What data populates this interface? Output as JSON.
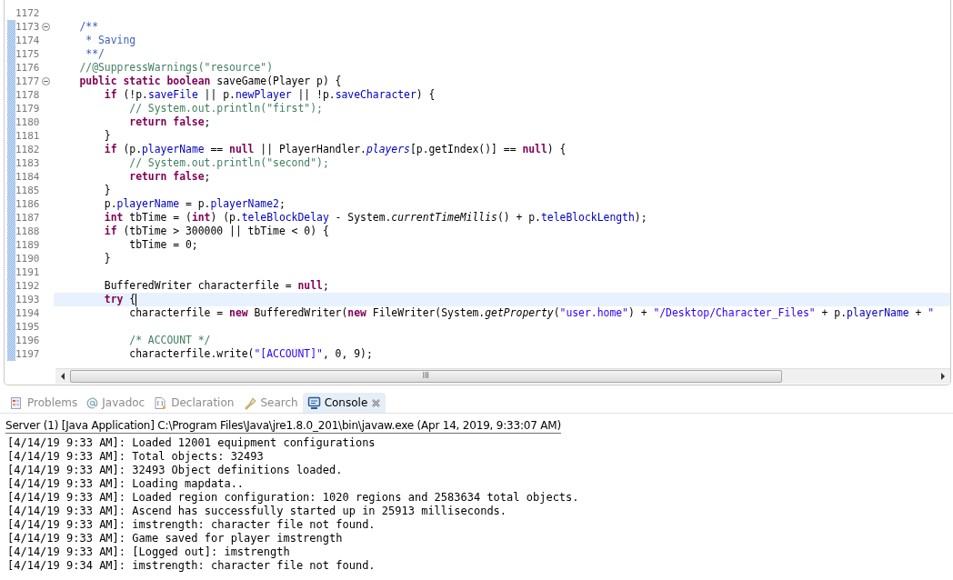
{
  "editor": {
    "lines": [
      {
        "number": "1172",
        "fold": false,
        "changed": false,
        "current": false
      },
      {
        "number": "1173",
        "fold": true,
        "changed": true,
        "current": false,
        "tokens": [
          {
            "text": "    /**",
            "kind": "javadoc"
          }
        ]
      },
      {
        "number": "1174",
        "fold": false,
        "changed": true,
        "current": false,
        "tokens": [
          {
            "text": "     * Saving",
            "kind": "javadoc"
          }
        ]
      },
      {
        "number": "1175",
        "fold": false,
        "changed": true,
        "current": false,
        "tokens": [
          {
            "text": "     **/",
            "kind": "javadoc"
          }
        ]
      },
      {
        "number": "1176",
        "fold": false,
        "changed": true,
        "current": false,
        "tokens": [
          {
            "text": "    //@SuppressWarnings(\"resource\")",
            "kind": "comment"
          }
        ]
      },
      {
        "number": "1177",
        "fold": true,
        "changed": true,
        "current": false,
        "tokens": [
          {
            "text": "    public static boolean",
            "kind": "keyword"
          },
          {
            "text": " saveGame(Player p) {",
            "kind": "plain"
          }
        ]
      },
      {
        "number": "1178",
        "fold": false,
        "changed": true,
        "current": false,
        "tokens": [
          {
            "text": "        if",
            "kind": "keyword"
          },
          {
            "text": " (!p.",
            "kind": "plain"
          },
          {
            "text": "saveFile",
            "kind": "field"
          },
          {
            "text": " || p.",
            "kind": "plain"
          },
          {
            "text": "newPlayer",
            "kind": "field"
          },
          {
            "text": " || !p.",
            "kind": "plain"
          },
          {
            "text": "saveCharacter",
            "kind": "field"
          },
          {
            "text": ") {",
            "kind": "plain"
          }
        ]
      },
      {
        "number": "1179",
        "fold": false,
        "changed": true,
        "current": false,
        "tokens": [
          {
            "text": "            // System.out.println(\"first\");",
            "kind": "comment"
          }
        ]
      },
      {
        "number": "1180",
        "fold": false,
        "changed": true,
        "current": false,
        "tokens": [
          {
            "text": "            return false",
            "kind": "keyword"
          },
          {
            "text": ";",
            "kind": "plain"
          }
        ]
      },
      {
        "number": "1181",
        "fold": false,
        "changed": true,
        "current": false,
        "tokens": [
          {
            "text": "        }",
            "kind": "plain"
          }
        ]
      },
      {
        "number": "1182",
        "fold": false,
        "changed": true,
        "current": false,
        "tokens": [
          {
            "text": "        if",
            "kind": "keyword"
          },
          {
            "text": " (p.",
            "kind": "plain"
          },
          {
            "text": "playerName",
            "kind": "field"
          },
          {
            "text": " == ",
            "kind": "plain"
          },
          {
            "text": "null",
            "kind": "keyword"
          },
          {
            "text": " || PlayerHandler.",
            "kind": "plain"
          },
          {
            "text": "players",
            "kind": "static_field"
          },
          {
            "text": "[p.getIndex()] == ",
            "kind": "plain"
          },
          {
            "text": "null",
            "kind": "keyword"
          },
          {
            "text": ") {",
            "kind": "plain"
          }
        ]
      },
      {
        "number": "1183",
        "fold": false,
        "changed": true,
        "current": false,
        "tokens": [
          {
            "text": "            // System.out.println(\"second\");",
            "kind": "comment"
          }
        ]
      },
      {
        "number": "1184",
        "fold": false,
        "changed": true,
        "current": false,
        "tokens": [
          {
            "text": "            return false",
            "kind": "keyword"
          },
          {
            "text": ";",
            "kind": "plain"
          }
        ]
      },
      {
        "number": "1185",
        "fold": false,
        "changed": true,
        "current": false,
        "tokens": [
          {
            "text": "        }",
            "kind": "plain"
          }
        ]
      },
      {
        "number": "1186",
        "fold": false,
        "changed": true,
        "current": false,
        "tokens": [
          {
            "text": "        p.",
            "kind": "plain"
          },
          {
            "text": "playerName",
            "kind": "field"
          },
          {
            "text": " = p.",
            "kind": "plain"
          },
          {
            "text": "playerName2",
            "kind": "field"
          },
          {
            "text": ";",
            "kind": "plain"
          }
        ]
      },
      {
        "number": "1187",
        "fold": false,
        "changed": true,
        "current": false,
        "tokens": [
          {
            "text": "        int",
            "kind": "keyword"
          },
          {
            "text": " tbTime = (",
            "kind": "plain"
          },
          {
            "text": "int",
            "kind": "keyword"
          },
          {
            "text": ") (p.",
            "kind": "plain"
          },
          {
            "text": "teleBlockDelay",
            "kind": "field"
          },
          {
            "text": " - System.",
            "kind": "plain"
          },
          {
            "text": "currentTimeMillis",
            "kind": "static_method"
          },
          {
            "text": "() + p.",
            "kind": "plain"
          },
          {
            "text": "teleBlockLength",
            "kind": "field"
          },
          {
            "text": ");",
            "kind": "plain"
          }
        ]
      },
      {
        "number": "1188",
        "fold": false,
        "changed": true,
        "current": false,
        "tokens": [
          {
            "text": "        if",
            "kind": "keyword"
          },
          {
            "text": " (tbTime > 300000 || tbTime < 0) {",
            "kind": "plain"
          }
        ]
      },
      {
        "number": "1189",
        "fold": false,
        "changed": true,
        "current": false,
        "tokens": [
          {
            "text": "            tbTime = 0;",
            "kind": "plain"
          }
        ]
      },
      {
        "number": "1190",
        "fold": false,
        "changed": true,
        "current": false,
        "tokens": [
          {
            "text": "        }",
            "kind": "plain"
          }
        ]
      },
      {
        "number": "1191",
        "fold": false,
        "changed": true,
        "current": false
      },
      {
        "number": "1192",
        "fold": false,
        "changed": true,
        "current": false,
        "tokens": [
          {
            "text": "        BufferedWriter characterfile = ",
            "kind": "plain"
          },
          {
            "text": "null",
            "kind": "keyword"
          },
          {
            "text": ";",
            "kind": "plain"
          }
        ]
      },
      {
        "number": "1193",
        "fold": false,
        "changed": true,
        "current": true,
        "tokens": [
          {
            "text": "        try",
            "kind": "keyword"
          },
          {
            "text": " {",
            "kind": "plain"
          }
        ]
      },
      {
        "number": "1194",
        "fold": false,
        "changed": true,
        "current": false,
        "tokens": [
          {
            "text": "            characterfile = ",
            "kind": "plain"
          },
          {
            "text": "new",
            "kind": "keyword"
          },
          {
            "text": " BufferedWriter(",
            "kind": "plain"
          },
          {
            "text": "new",
            "kind": "keyword"
          },
          {
            "text": " FileWriter(System.",
            "kind": "plain"
          },
          {
            "text": "getProperty",
            "kind": "static_method"
          },
          {
            "text": "(",
            "kind": "plain"
          },
          {
            "text": "\"user.home\"",
            "kind": "string"
          },
          {
            "text": ") + ",
            "kind": "plain"
          },
          {
            "text": "\"/Desktop/Character_Files\"",
            "kind": "string"
          },
          {
            "text": " + p.",
            "kind": "plain"
          },
          {
            "text": "playerName",
            "kind": "field"
          },
          {
            "text": " + ",
            "kind": "plain"
          },
          {
            "text": "\"",
            "kind": "string"
          }
        ]
      },
      {
        "number": "1195",
        "fold": false,
        "changed": true,
        "current": false
      },
      {
        "number": "1196",
        "fold": false,
        "changed": true,
        "current": false,
        "tokens": [
          {
            "text": "            /* ACCOUNT */",
            "kind": "comment"
          }
        ]
      },
      {
        "number": "1197",
        "fold": false,
        "changed": true,
        "current": false,
        "tokens": [
          {
            "text": "            characterfile.write(",
            "kind": "plain"
          },
          {
            "text": "\"[ACCOUNT]\"",
            "kind": "string"
          },
          {
            "text": ", 0, 9);",
            "kind": "plain"
          }
        ]
      }
    ],
    "scrollbar_grip": "III"
  },
  "panel_tabs": [
    {
      "label": "Problems",
      "kind": "problems",
      "selected": false
    },
    {
      "label": "Javadoc",
      "kind": "javadoc",
      "selected": false
    },
    {
      "label": "Declaration",
      "kind": "declaration",
      "selected": false
    },
    {
      "label": "Search",
      "kind": "search",
      "selected": false
    },
    {
      "label": "Console",
      "kind": "console",
      "selected": true,
      "closable": true
    }
  ],
  "console": {
    "process": "Server (1) [Java Application] C:\\Program Files\\Java\\jre1.8.0_201\\bin\\javaw.exe (Apr 14, 2019, 9:33:07 AM)",
    "lines": [
      "[4/14/19 9:33 AM]: Loaded 12001 equipment configurations",
      "[4/14/19 9:33 AM]: Total objects: 32493",
      "[4/14/19 9:33 AM]: 32493 Object definitions loaded.",
      "[4/14/19 9:33 AM]: Loading mapdata..",
      "[4/14/19 9:33 AM]: Loaded region configuration: 1020 regions and 2583634 total objects.",
      "[4/14/19 9:33 AM]: Ascend has successfully started up in 25913 milliseconds.",
      "[4/14/19 9:33 AM]: imstrength: character file not found.",
      "[4/14/19 9:33 AM]: Game saved for player imstrength",
      "[4/14/19 9:33 AM]: [Logged out]: imstrength",
      "[4/14/19 9:34 AM]: imstrength: character file not found."
    ]
  }
}
